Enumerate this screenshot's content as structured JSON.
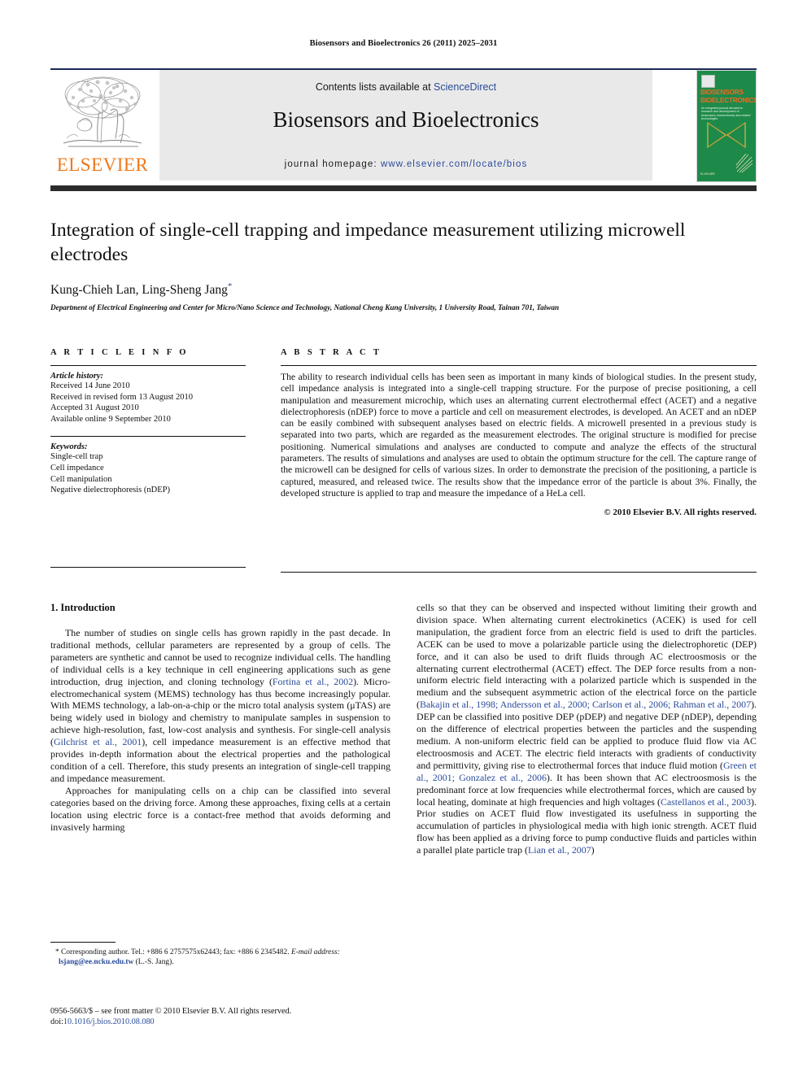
{
  "running_head": "Biosensors and Bioelectronics 26 (2011) 2025–2031",
  "journal_header": {
    "contents_prefix": "Contents lists available at ",
    "contents_link": "ScienceDirect",
    "journal_title": "Biosensors and Bioelectronics",
    "homepage_prefix": "journal homepage: ",
    "homepage_url": "www.elsevier.com/locate/bios",
    "publisher_logo_text": "ELSEVIER",
    "cover": {
      "line1": "BIOSENSORS",
      "line2": "BIOELECTRONICS",
      "subtitle": "An integrated journal devoted to research and development of biosensors, bioelectronics and related technologies",
      "bottom_text": "ELSEVIER"
    }
  },
  "article": {
    "title": "Integration of single-cell trapping and impedance measurement utilizing microwell electrodes",
    "authors": "Kung-Chieh Lan, Ling-Sheng Jang",
    "corresponding_marker": "*",
    "affiliation": "Department of Electrical Engineering and Center for Micro/Nano Science and Technology, National Cheng Kung University, 1 University Road, Tainan 701, Taiwan"
  },
  "article_info": {
    "heading": "A R T I C L E   I N F O",
    "history_label": "Article history:",
    "history": [
      "Received 14 June 2010",
      "Received in revised form 13 August 2010",
      "Accepted 31 August 2010",
      "Available online 9 September 2010"
    ],
    "keywords_label": "Keywords:",
    "keywords": [
      "Single-cell trap",
      "Cell impedance",
      "Cell manipulation",
      "Negative dielectrophoresis (nDEP)"
    ]
  },
  "abstract": {
    "heading": "A B S T R A C T",
    "text": "The ability to research individual cells has been seen as important in many kinds of biological studies. In the present study, cell impedance analysis is integrated into a single-cell trapping structure. For the purpose of precise positioning, a cell manipulation and measurement microchip, which uses an alternating current electrothermal effect (ACET) and a negative dielectrophoresis (nDEP) force to move a particle and cell on measurement electrodes, is developed. An ACET and an nDEP can be easily combined with subsequent analyses based on electric fields. A microwell presented in a previous study is separated into two parts, which are regarded as the measurement electrodes. The original structure is modified for precise positioning. Numerical simulations and analyses are conducted to compute and analyze the effects of the structural parameters. The results of simulations and analyses are used to obtain the optimum structure for the cell. The capture range of the microwell can be designed for cells of various sizes. In order to demonstrate the precision of the positioning, a particle is captured, measured, and released twice. The results show that the impedance error of the particle is about 3%. Finally, the developed structure is applied to trap and measure the impedance of a HeLa cell.",
    "copyright": "© 2010 Elsevier B.V. All rights reserved."
  },
  "body": {
    "section_heading": "1.  Introduction",
    "left_paragraph_1_a": "The number of studies on single cells has grown rapidly in the past decade. In traditional methods, cellular parameters are represented by a group of cells. The parameters are synthetic and cannot be used to recognize individual cells. The handling of individual cells is a key technique in cell engineering applications such as gene introduction, drug injection, and cloning technology (",
    "ref_fortina": "Fortina et al., 2002",
    "left_paragraph_1_b": "). Micro-electromechanical system (MEMS) technology has thus become increasingly popular. With MEMS technology, a lab-on-a-chip or the micro total analysis system (μTAS) are being widely used in biology and chemistry to manipulate samples in suspension to achieve high-resolution, fast, low-cost analysis and synthesis. For single-cell analysis (",
    "ref_gilchrist": "Gilchrist et al., 2001",
    "left_paragraph_1_c": "), cell impedance measurement is an effective method that provides in-depth information about the electrical properties and the pathological condition of a cell. Therefore, this study presents an integration of single-cell trapping and impedance measurement.",
    "left_paragraph_2": "Approaches for manipulating cells on a chip can be classified into several categories based on the driving force. Among these approaches, fixing cells at a certain location using electric force is a contact-free method that avoids deforming and invasively harming",
    "right_paragraph_a": "cells so that they can be observed and inspected without limiting their growth and division space. When alternating current electrokinetics (ACEK) is used for cell manipulation, the gradient force from an electric field is used to drift the particles. ACEK can be used to move a polarizable particle using the dielectrophoretic (DEP) force, and it can also be used to drift fluids through AC electroosmosis or the alternating current electrothermal (ACET) effect. The DEP force results from a non-uniform electric field interacting with a polarized particle which is suspended in the medium and the subsequent asymmetric action of the electrical force on the particle (",
    "ref_group_1": "Bakajin et al., 1998; Andersson et al., 2000; Carlson et al., 2006; Rahman et al., 2007",
    "right_paragraph_b": "). DEP can be classified into positive DEP (pDEP) and negative DEP (nDEP), depending on the difference of electrical properties between the particles and the suspending medium. A non-uniform electric field can be applied to produce fluid flow via AC electroosmosis and ACET. The electric field interacts with gradients of conductivity and permittivity, giving rise to electrothermal forces that induce fluid motion (",
    "ref_group_2": "Green et al., 2001; Gonzalez et al., 2006",
    "right_paragraph_c": "). It has been shown that AC electroosmosis is the predominant force at low frequencies while electrothermal forces, which are caused by local heating, dominate at high frequencies and high voltages (",
    "ref_castellanos": "Castellanos et al., 2003",
    "right_paragraph_d": "). Prior studies on ACET fluid flow investigated its usefulness in supporting the accumulation of particles in physiological media with high ionic strength. ACET fluid flow has been applied as a driving force to pump conductive fluids and particles within a parallel plate particle trap (",
    "ref_lian": "Lian et al., 2007",
    "right_paragraph_e": ")"
  },
  "footnote": {
    "marker": "*",
    "corresponding": "Corresponding author. Tel.: +886 6 2757575x62443; fax: +886 6 2345482.",
    "email_label": "E-mail address:",
    "email": "lsjang@ee.ncku.edu.tw",
    "email_suffix": "(L.-S. Jang)."
  },
  "issn": {
    "line1": "0956-5663/$ – see front matter © 2010 Elsevier B.V. All rights reserved.",
    "doi_label": "doi:",
    "doi": "10.1016/j.bios.2010.08.080"
  },
  "colors": {
    "link": "#2a4b9b",
    "elsevier_orange": "#f07818",
    "cover_green": "#1e8a4a",
    "rule_navy": "#1b2a55"
  }
}
